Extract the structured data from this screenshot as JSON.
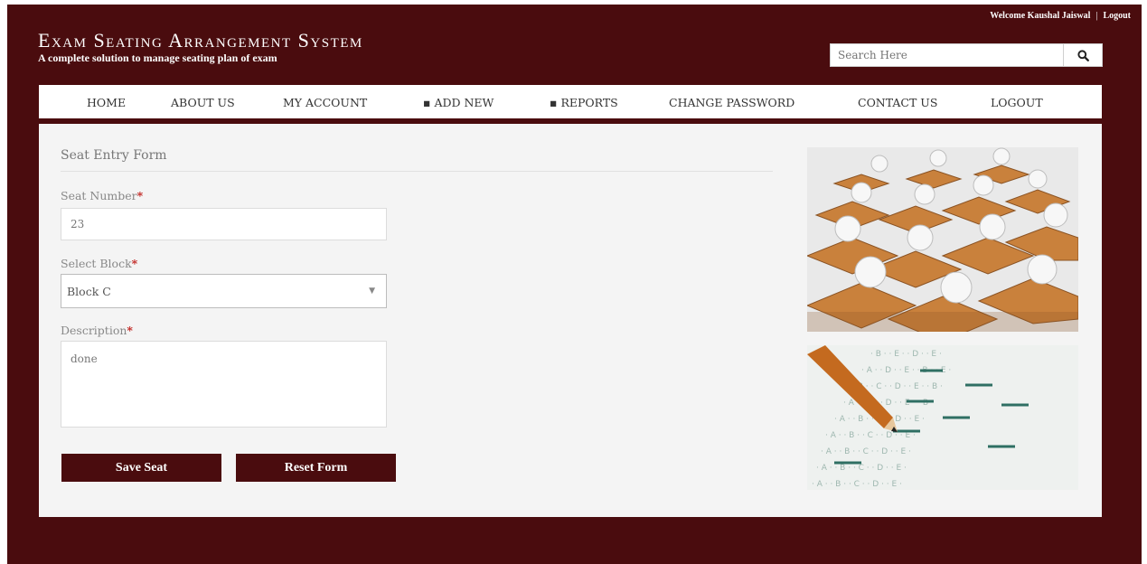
{
  "header": {
    "title": "Exam Seating Arrangement System",
    "subtitle": "A complete solution to manage seating plan of exam",
    "welcome": "Welcome Kaushal Jaiswal",
    "separator": "|",
    "logout": "Logout",
    "search_placeholder": "Search Here",
    "search_icon": "search-icon"
  },
  "nav": {
    "items": [
      {
        "label": "HOME"
      },
      {
        "label": "ABOUT US"
      },
      {
        "label": "MY ACCOUNT"
      },
      {
        "label": "▪ ADD NEW"
      },
      {
        "label": "▪ REPORTS"
      },
      {
        "label": "CHANGE PASSWORD"
      },
      {
        "label": "CONTACT US"
      },
      {
        "label": "LOGOUT"
      }
    ]
  },
  "form": {
    "title": "Seat Entry Form",
    "seat_number_label": "Seat Number",
    "seat_number_value": "23",
    "block_label": "Select Block",
    "block_value": "Block C",
    "description_label": "Description",
    "description_value": "done",
    "required_mark": "*",
    "save_label": "Save Seat",
    "reset_label": "Reset Form"
  },
  "colors": {
    "brand": "#4a0c0e",
    "required": "#c0201c"
  }
}
